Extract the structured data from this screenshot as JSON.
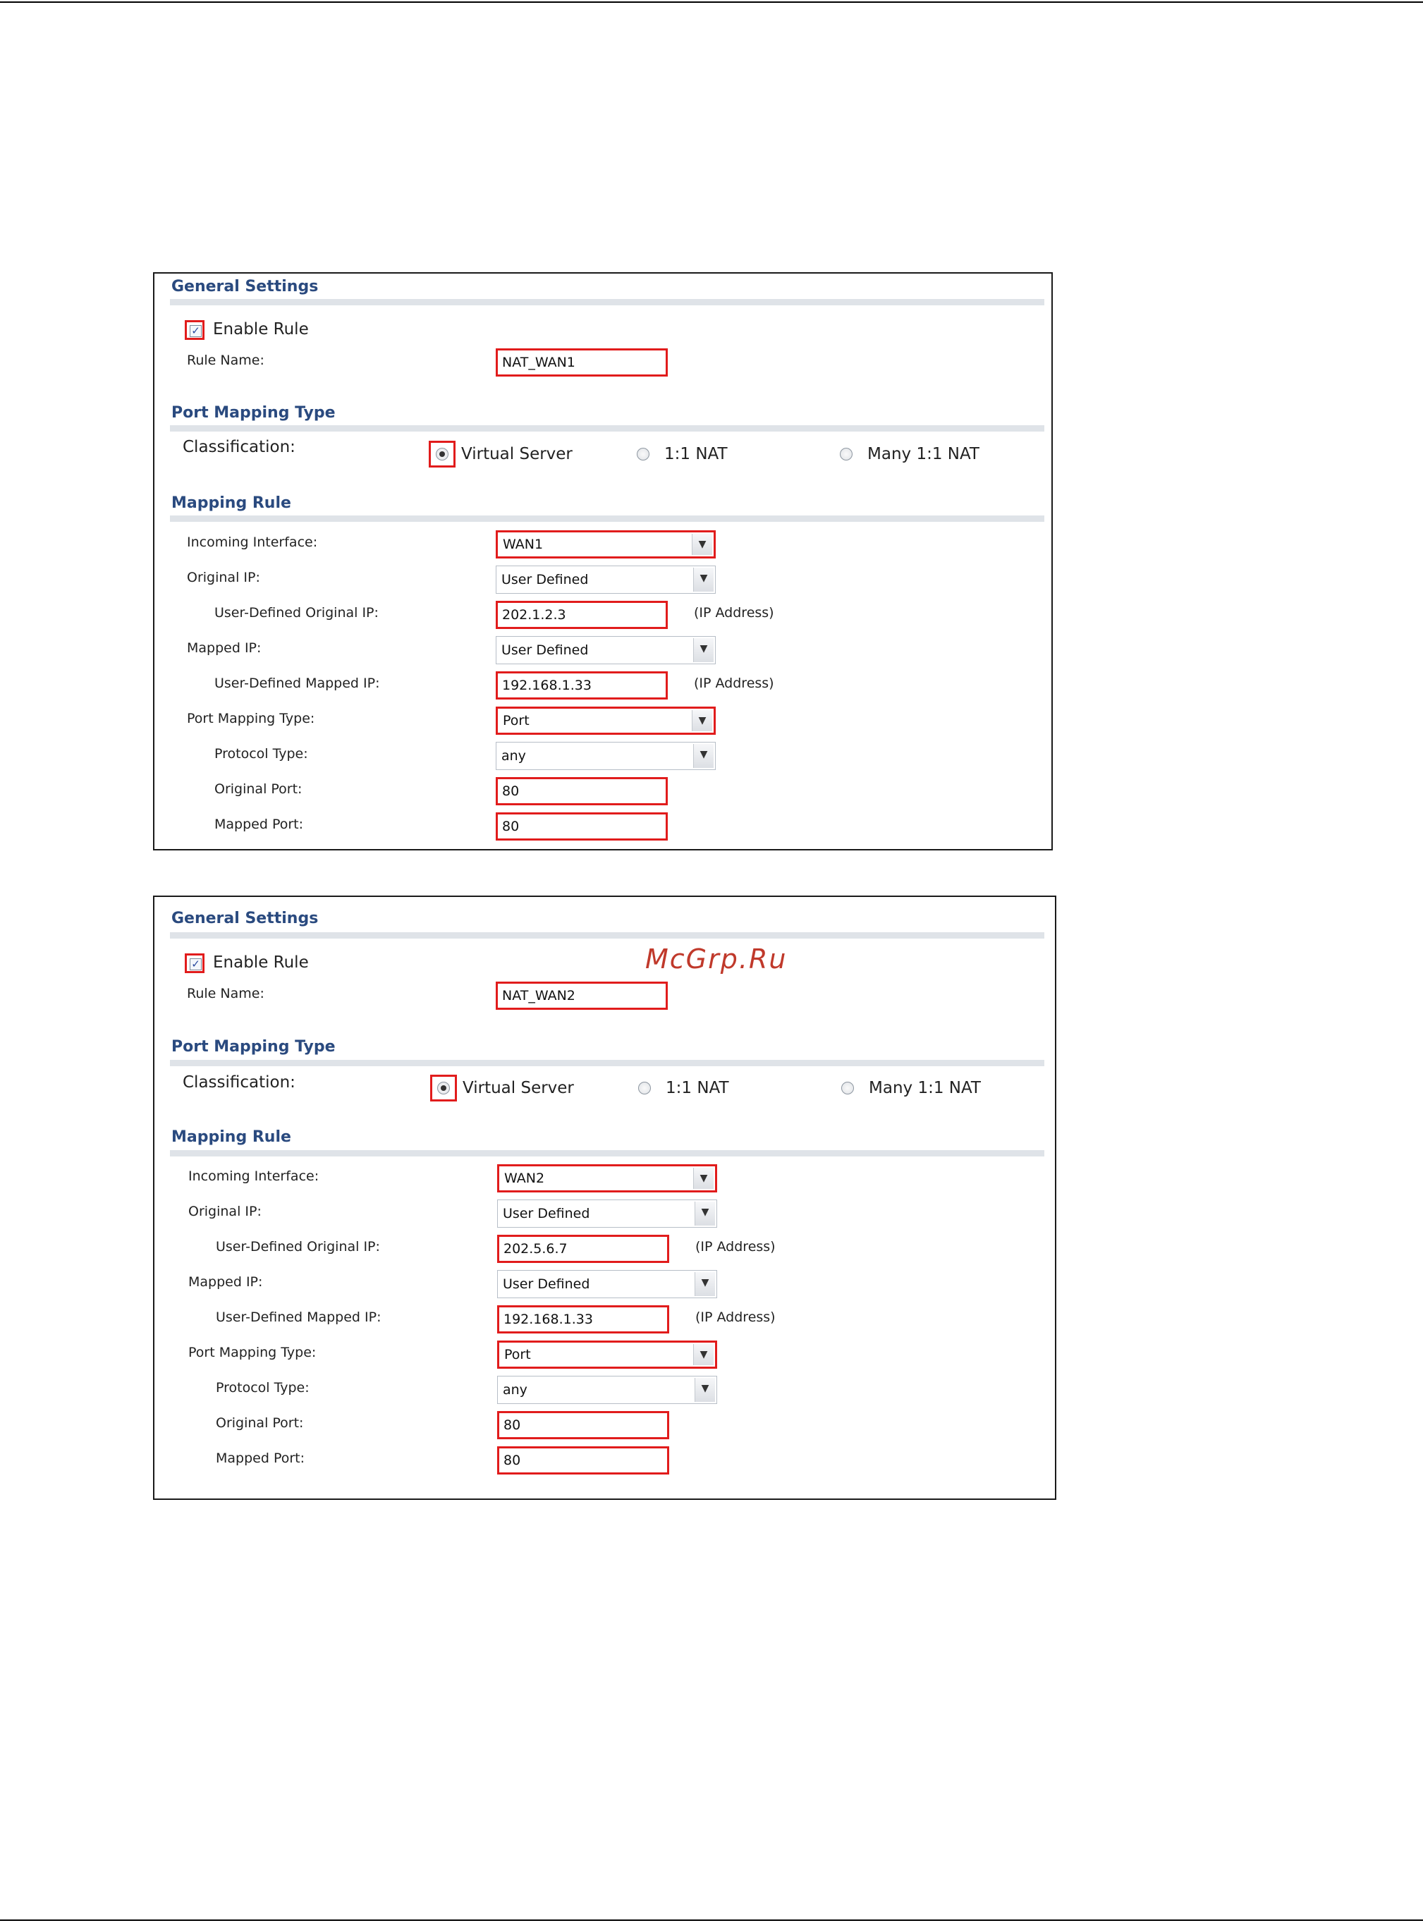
{
  "watermark": "McGrp.Ru",
  "rules": [
    {
      "general_settings_title": "General Settings",
      "enable_rule_label": "Enable Rule",
      "enable_rule_checked": true,
      "rule_name_label": "Rule Name:",
      "rule_name_value": "NAT_WAN1",
      "port_mapping_type_title": "Port Mapping Type",
      "classification_label": "Classification:",
      "classification_options": [
        "Virtual Server",
        "1:1 NAT",
        "Many 1:1 NAT"
      ],
      "classification_selected": "Virtual Server",
      "mapping_rule_title": "Mapping Rule",
      "incoming_interface_label": "Incoming Interface:",
      "incoming_interface_value": "WAN1",
      "original_ip_label": "Original IP:",
      "original_ip_value": "User Defined",
      "user_defined_original_ip_label": "User-Defined Original IP:",
      "user_defined_original_ip_value": "202.1.2.3",
      "ip_address_hint": "(IP Address)",
      "mapped_ip_label": "Mapped IP:",
      "mapped_ip_value": "User Defined",
      "user_defined_mapped_ip_label": "User-Defined Mapped IP:",
      "user_defined_mapped_ip_value": "192.168.1.33",
      "port_mapping_type_label": "Port Mapping Type:",
      "port_mapping_type_value": "Port",
      "protocol_type_label": "Protocol Type:",
      "protocol_type_value": "any",
      "original_port_label": "Original Port:",
      "original_port_value": "80",
      "mapped_port_label": "Mapped Port:",
      "mapped_port_value": "80"
    },
    {
      "general_settings_title": "General Settings",
      "enable_rule_label": "Enable Rule",
      "enable_rule_checked": true,
      "rule_name_label": "Rule Name:",
      "rule_name_value": "NAT_WAN2",
      "port_mapping_type_title": "Port Mapping Type",
      "classification_label": "Classification:",
      "classification_options": [
        "Virtual Server",
        "1:1 NAT",
        "Many 1:1 NAT"
      ],
      "classification_selected": "Virtual Server",
      "mapping_rule_title": "Mapping Rule",
      "incoming_interface_label": "Incoming Interface:",
      "incoming_interface_value": "WAN2",
      "original_ip_label": "Original IP:",
      "original_ip_value": "User Defined",
      "user_defined_original_ip_label": "User-Defined Original IP:",
      "user_defined_original_ip_value": "202.5.6.7",
      "ip_address_hint": "(IP Address)",
      "mapped_ip_label": "Mapped IP:",
      "mapped_ip_value": "User Defined",
      "user_defined_mapped_ip_label": "User-Defined Mapped IP:",
      "user_defined_mapped_ip_value": "192.168.1.33",
      "port_mapping_type_label": "Port Mapping Type:",
      "port_mapping_type_value": "Port",
      "protocol_type_label": "Protocol Type:",
      "protocol_type_value": "any",
      "original_port_label": "Original Port:",
      "original_port_value": "80",
      "mapped_port_label": "Mapped Port:",
      "mapped_port_value": "80"
    }
  ]
}
